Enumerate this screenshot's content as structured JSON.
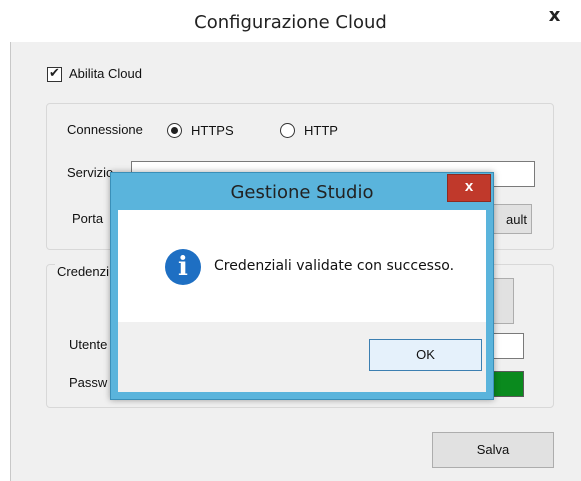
{
  "window": {
    "title": "Configurazione Cloud",
    "close_glyph": "x"
  },
  "cloud_checkbox": {
    "label": "Abilita Cloud",
    "checked": true
  },
  "connection": {
    "label": "Connessione",
    "options": [
      {
        "label": "HTTPS",
        "selected": true
      },
      {
        "label": "HTTP",
        "selected": false
      }
    ],
    "service_label": "Servizio",
    "service_value": "",
    "port_label": "Porta",
    "default_button_label": "ault"
  },
  "credentials": {
    "group_label": "Credenzi",
    "user_label": "Utente",
    "password_label": "Passw",
    "status_color": "#0a8a1e"
  },
  "save_button_label": "Salva",
  "dialog": {
    "title": "Gestione Studio",
    "close_glyph": "x",
    "icon": "info-icon",
    "message": "Credenziali validate con successo.",
    "ok_label": "OK"
  }
}
